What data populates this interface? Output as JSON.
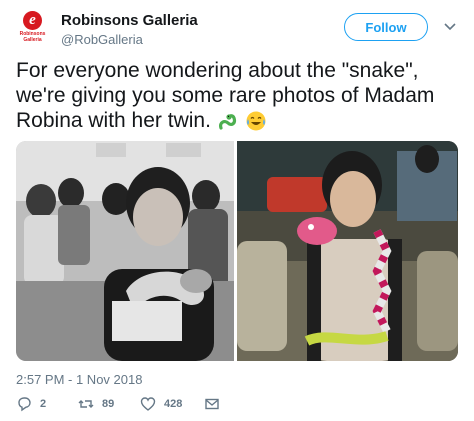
{
  "account": {
    "name": "Robinsons Galleria",
    "handle": "@RobGalleria",
    "avatar_logo_letter": "e",
    "avatar_logo_text": "Robinsons Galleria",
    "brand_color": "#d71920"
  },
  "follow_button": {
    "label": "Follow",
    "color": "#1da1f2"
  },
  "menu": {
    "icon": "chevron-down-icon"
  },
  "tweet": {
    "text": "For everyone wondering about the \"snake\", we're giving you some rare photos of Madam Robina with her twin.",
    "emojis": [
      "snake-emoji",
      "tears-of-joy-emoji"
    ]
  },
  "media": {
    "photos": [
      {
        "name": "photo-black-and-white-office",
        "style": "grayscale"
      },
      {
        "name": "photo-color-lounge",
        "style": "color"
      }
    ]
  },
  "timestamp": "2:57 PM - 1 Nov 2018",
  "actions": {
    "reply": {
      "icon": "reply-icon",
      "count": "2"
    },
    "retweet": {
      "icon": "retweet-icon",
      "count": "89"
    },
    "like": {
      "icon": "heart-icon",
      "count": "428"
    },
    "dm": {
      "icon": "envelope-icon"
    }
  }
}
